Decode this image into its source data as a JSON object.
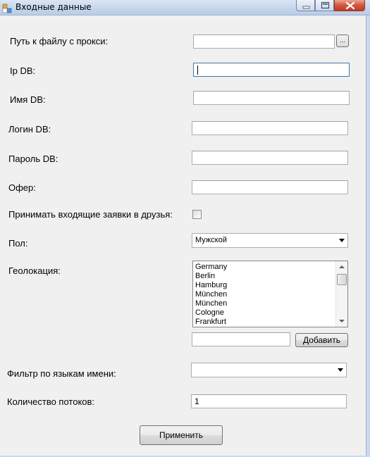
{
  "window": {
    "title": "Входные данные"
  },
  "form": {
    "proxy_path": {
      "label": "Путь к файлу с прокси:",
      "value": "",
      "browse_label": "..."
    },
    "ip_db": {
      "label": "Ip DB:",
      "value": ""
    },
    "db_name": {
      "label": "Имя DB:",
      "value": ""
    },
    "db_login": {
      "label": "Логин DB:",
      "value": ""
    },
    "db_password": {
      "label": "Пароль DB:",
      "value": ""
    },
    "offer": {
      "label": "Офер:",
      "value": ""
    },
    "accept_friends": {
      "label": "Принимать входящие заявки в друзья:",
      "checked": false
    },
    "gender": {
      "label": "Пол:",
      "selected": "Мужской"
    },
    "geolocation": {
      "label": "Геолокация:",
      "items": [
        "Germany",
        "Berlin",
        "Hamburg",
        "München",
        "München",
        "Cologne",
        "Frankfurt"
      ],
      "add_value": "",
      "add_label": "Добавить"
    },
    "name_language_filter": {
      "label": "Фильтр по языкам имени:",
      "selected": ""
    },
    "thread_count": {
      "label": "Количество потоков:",
      "value": "1"
    },
    "apply_label": "Применить"
  }
}
